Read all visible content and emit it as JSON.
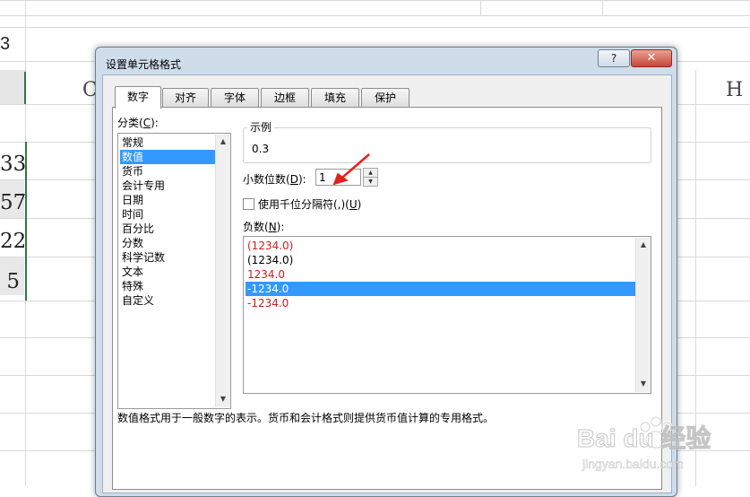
{
  "sheet": {
    "formula_value": "3",
    "column_letters": [
      "C",
      "H"
    ],
    "cell_values": [
      "33",
      "57",
      "22",
      "5"
    ]
  },
  "dialog": {
    "title": "设置单元格格式",
    "help_label": "?",
    "close_label": "✕",
    "tabs": [
      "数字",
      "对齐",
      "字体",
      "边框",
      "填充",
      "保护"
    ],
    "active_tab": "数字",
    "category_label": "分类(",
    "category_accel": "C",
    "category_label_end": "):",
    "categories": [
      "常规",
      "数值",
      "货币",
      "会计专用",
      "日期",
      "时间",
      "百分比",
      "分数",
      "科学记数",
      "文本",
      "特殊",
      "自定义"
    ],
    "selected_category": "数值",
    "sample_title": "示例",
    "sample_value": "0.3",
    "decimal_label": "小数位数(",
    "decimal_accel": "D",
    "decimal_label_end": "):",
    "decimal_value": "1",
    "thousands_label": "使用千位分隔符(,)(",
    "thousands_accel": "U",
    "thousands_label_end": ")",
    "thousands_checked": false,
    "negative_label": "负数(",
    "negative_accel": "N",
    "negative_label_end": "):",
    "negative_options": [
      "(1234.0)",
      "(1234.0)",
      "1234.0",
      "-1234.0",
      "-1234.0"
    ],
    "negative_option_colors": [
      "#d21b1b",
      "#000000",
      "#d21b1b",
      "#ffffff",
      "#d21b1b"
    ],
    "selected_negative_index": 3,
    "description": "数值格式用于一般数字的表示。货币和会计格式则提供货币值计算的专用格式。"
  },
  "watermark": {
    "brand_text": "Bai du 经验",
    "url_text": "jingyan.baidu.com"
  },
  "colors": {
    "selection": "#3399ff",
    "negative_red": "#d21b1b",
    "sheet_accent": "#2a7a44",
    "annotation_arrow": "#e3231b"
  }
}
